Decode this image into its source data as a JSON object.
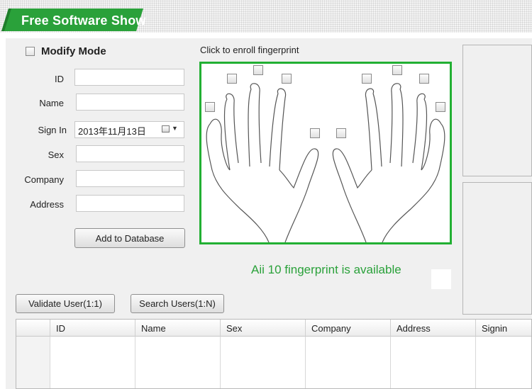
{
  "banner": {
    "title": "Free Software Show"
  },
  "form": {
    "modify_mode_label": "Modify Mode",
    "enroll_hint": "Click to enroll fingerprint",
    "fields": [
      {
        "label": "ID",
        "value": ""
      },
      {
        "label": "Name",
        "value": ""
      },
      {
        "label": "Sign In",
        "value": "2013年11月13日"
      },
      {
        "label": "Sex",
        "value": ""
      },
      {
        "label": "Company",
        "value": ""
      },
      {
        "label": "Address",
        "value": ""
      }
    ],
    "add_button": "Add to Database"
  },
  "status": {
    "message": "Aii 10 fingerprint is available"
  },
  "actions": {
    "validate": "Validate User(1:1)",
    "search": "Search Users(1:N)"
  },
  "table": {
    "columns": [
      "ID",
      "Name",
      "Sex",
      "Company",
      "Address",
      "Signin"
    ]
  },
  "colors": {
    "accent": "#2aa13a",
    "frame": "#22b033"
  }
}
